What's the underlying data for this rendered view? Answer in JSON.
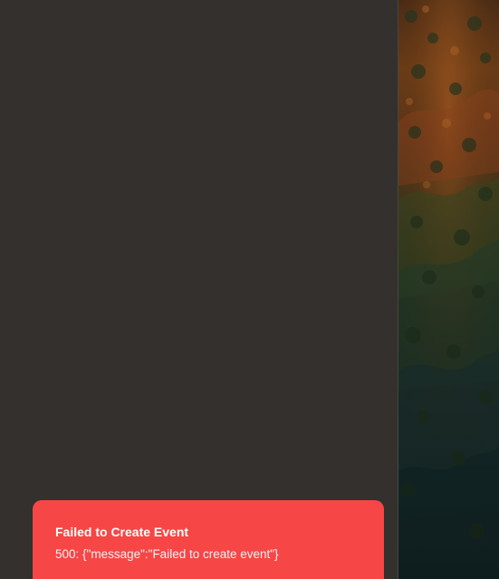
{
  "toast": {
    "title": "Failed to Create Event",
    "message": "500: {\"message\":\"Failed to create event\"}",
    "status": "error",
    "background_color": "#f64646",
    "text_color": "#ffffff"
  },
  "layout": {
    "panel_color": "#33302d",
    "divider_color": "#4a4541"
  },
  "background_image": {
    "description_icon": "landscape-image"
  }
}
